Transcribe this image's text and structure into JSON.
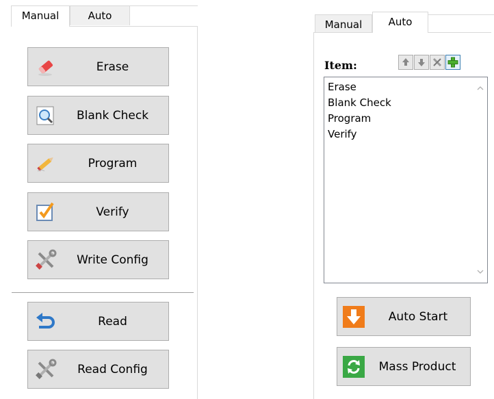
{
  "manual_panel": {
    "tabs": [
      {
        "label": "Manual",
        "active": true
      },
      {
        "label": "Auto",
        "active": false
      }
    ],
    "buttons": [
      {
        "label": "Erase",
        "icon": "eraser-icon"
      },
      {
        "label": "Blank Check",
        "icon": "magnifier-icon"
      },
      {
        "label": "Program",
        "icon": "pencil-icon"
      },
      {
        "label": "Verify",
        "icon": "checkbox-icon"
      },
      {
        "label": "Write Config",
        "icon": "tools-icon"
      },
      {
        "label": "Read",
        "icon": "undo-arrow-icon"
      },
      {
        "label": "Read Config",
        "icon": "tools-icon"
      }
    ]
  },
  "auto_panel": {
    "tabs": [
      {
        "label": "Manual",
        "active": false
      },
      {
        "label": "Auto",
        "active": true
      }
    ],
    "item_label": "Item:",
    "toolbar_icons": [
      "move-up-icon",
      "move-down-icon",
      "remove-icon",
      "add-icon"
    ],
    "items": [
      "Erase",
      "Blank Check",
      "Program",
      "Verify"
    ],
    "buttons": [
      {
        "label": "Auto Start",
        "icon": "download-arrow-icon",
        "color": "#f07c1a"
      },
      {
        "label": "Mass Product",
        "icon": "refresh-icon",
        "color": "#3aa845"
      }
    ]
  }
}
